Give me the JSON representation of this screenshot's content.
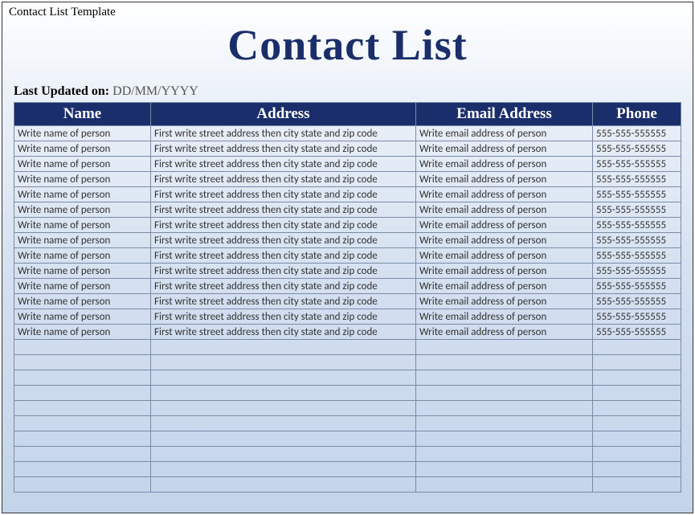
{
  "template_label": "Contact List Template",
  "title": "Contact List",
  "updated": {
    "label": "Last Updated on: ",
    "value": "DD/MM/YYYY"
  },
  "table": {
    "headers": {
      "name": "Name",
      "address": "Address",
      "email": "Email Address",
      "phone": "Phone"
    },
    "rows": [
      {
        "name": "Write name of person",
        "address": "First write street address then city state and zip code",
        "email": "Write email address of person",
        "phone": "555-555-555555"
      },
      {
        "name": "Write name of person",
        "address": "First write street address then city state and zip code",
        "email": "Write email address of person",
        "phone": "555-555-555555"
      },
      {
        "name": "Write name of person",
        "address": "First write street address then city state and zip code",
        "email": "Write email address of person",
        "phone": "555-555-555555"
      },
      {
        "name": "Write name of person",
        "address": "First write street address then city state and zip code",
        "email": "Write email address of person",
        "phone": "555-555-555555"
      },
      {
        "name": "Write name of person",
        "address": "First write street address then city state and zip code",
        "email": "Write email address of person",
        "phone": "555-555-555555"
      },
      {
        "name": "Write name of person",
        "address": "First write street address then city state and zip code",
        "email": "Write email address of person",
        "phone": "555-555-555555"
      },
      {
        "name": "Write name of person",
        "address": "First write street address then city state and zip code",
        "email": "Write email address of person",
        "phone": "555-555-555555"
      },
      {
        "name": "Write name of person",
        "address": "First write street address then city state and zip code",
        "email": "Write email address of person",
        "phone": "555-555-555555"
      },
      {
        "name": "Write name of person",
        "address": "First write street address then city state and zip code",
        "email": "Write email address of person",
        "phone": "555-555-555555"
      },
      {
        "name": "Write name of person",
        "address": "First write street address then city state and zip code",
        "email": "Write email address of person",
        "phone": "555-555-555555"
      },
      {
        "name": "Write name of person",
        "address": "First write street address then city state and zip code",
        "email": "Write email address of person",
        "phone": "555-555-555555"
      },
      {
        "name": "Write name of person",
        "address": "First write street address then city state and zip code",
        "email": "Write email address of person",
        "phone": "555-555-555555"
      },
      {
        "name": "Write name of person",
        "address": "First write street address then city state and zip code",
        "email": "Write email address of person",
        "phone": "555-555-555555"
      },
      {
        "name": "Write name of person",
        "address": "First write street address then city state and zip code",
        "email": "Write email address of person",
        "phone": "555-555-555555"
      }
    ],
    "empty_rows": 10
  }
}
